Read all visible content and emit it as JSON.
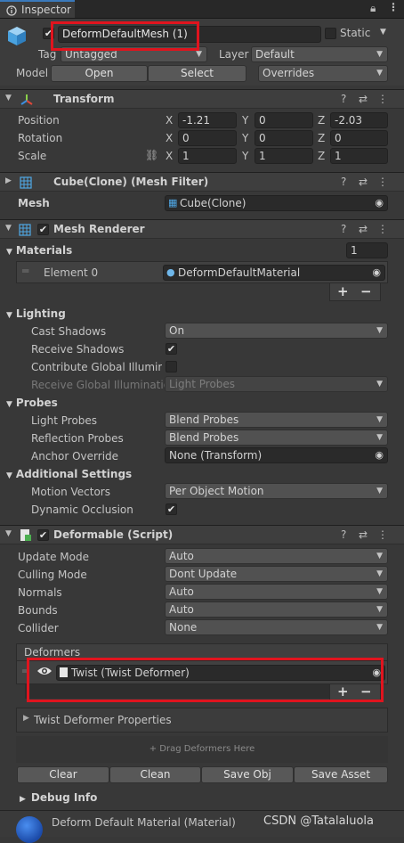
{
  "window": {
    "tab_label": "Inspector"
  },
  "header": {
    "object_name": "DeformDefaultMesh (1)",
    "static_label": "Static",
    "tag_label": "Tag",
    "tag_value": "Untagged",
    "layer_label": "Layer",
    "layer_value": "Default",
    "model_label": "Model",
    "open_button": "Open",
    "select_button": "Select",
    "overrides_value": "Overrides"
  },
  "transform": {
    "title": "Transform",
    "position_label": "Position",
    "rotation_label": "Rotation",
    "scale_label": "Scale",
    "position": {
      "x": "-1.21",
      "y": "0",
      "z": "-2.03"
    },
    "rotation": {
      "x": "0",
      "y": "0",
      "z": "0"
    },
    "scale": {
      "x": "1",
      "y": "1",
      "z": "1"
    },
    "axis_x": "X",
    "axis_y": "Y",
    "axis_z": "Z"
  },
  "mesh_filter": {
    "title": "Cube(Clone) (Mesh Filter)",
    "mesh_label": "Mesh",
    "mesh_value": "Cube(Clone)"
  },
  "mesh_renderer": {
    "title": "Mesh Renderer",
    "materials_label": "Materials",
    "materials_count": "1",
    "element0_label": "Element 0",
    "element0_value": "DeformDefaultMaterial",
    "lighting_label": "Lighting",
    "cast_shadows_label": "Cast Shadows",
    "cast_shadows_value": "On",
    "receive_shadows_label": "Receive Shadows",
    "contribute_gi_label": "Contribute Global Illuminat",
    "receive_gi_label": "Receive Global Illumination",
    "receive_gi_value": "Light Probes",
    "probes_label": "Probes",
    "light_probes_label": "Light Probes",
    "light_probes_value": "Blend Probes",
    "reflection_probes_label": "Reflection Probes",
    "reflection_probes_value": "Blend Probes",
    "anchor_override_label": "Anchor Override",
    "anchor_override_value": "None (Transform)",
    "additional_settings_label": "Additional Settings",
    "motion_vectors_label": "Motion Vectors",
    "motion_vectors_value": "Per Object Motion",
    "dynamic_occlusion_label": "Dynamic Occlusion"
  },
  "deformable": {
    "title": "Deformable (Script)",
    "update_mode_label": "Update Mode",
    "update_mode_value": "Auto",
    "culling_mode_label": "Culling Mode",
    "culling_mode_value": "Dont Update",
    "normals_label": "Normals",
    "normals_value": "Auto",
    "bounds_label": "Bounds",
    "bounds_value": "Auto",
    "collider_label": "Collider",
    "collider_value": "None",
    "deformers_label": "Deformers",
    "deformer_item": "Twist (Twist Deformer)",
    "twist_props_label": "Twist Deformer Properties",
    "drag_hint": "+ Drag Deformers Here",
    "clear_button": "Clear",
    "clean_button": "Clean",
    "save_obj_button": "Save Obj",
    "save_asset_button": "Save Asset",
    "debug_info_label": "Debug Info"
  },
  "material_preview": {
    "label": "Deform Default Material (Material)"
  },
  "watermark": "CSDN @Tatalaluola",
  "colors": {
    "highlight_red": "#e0141e",
    "accent_blue": "#3a79bb"
  }
}
